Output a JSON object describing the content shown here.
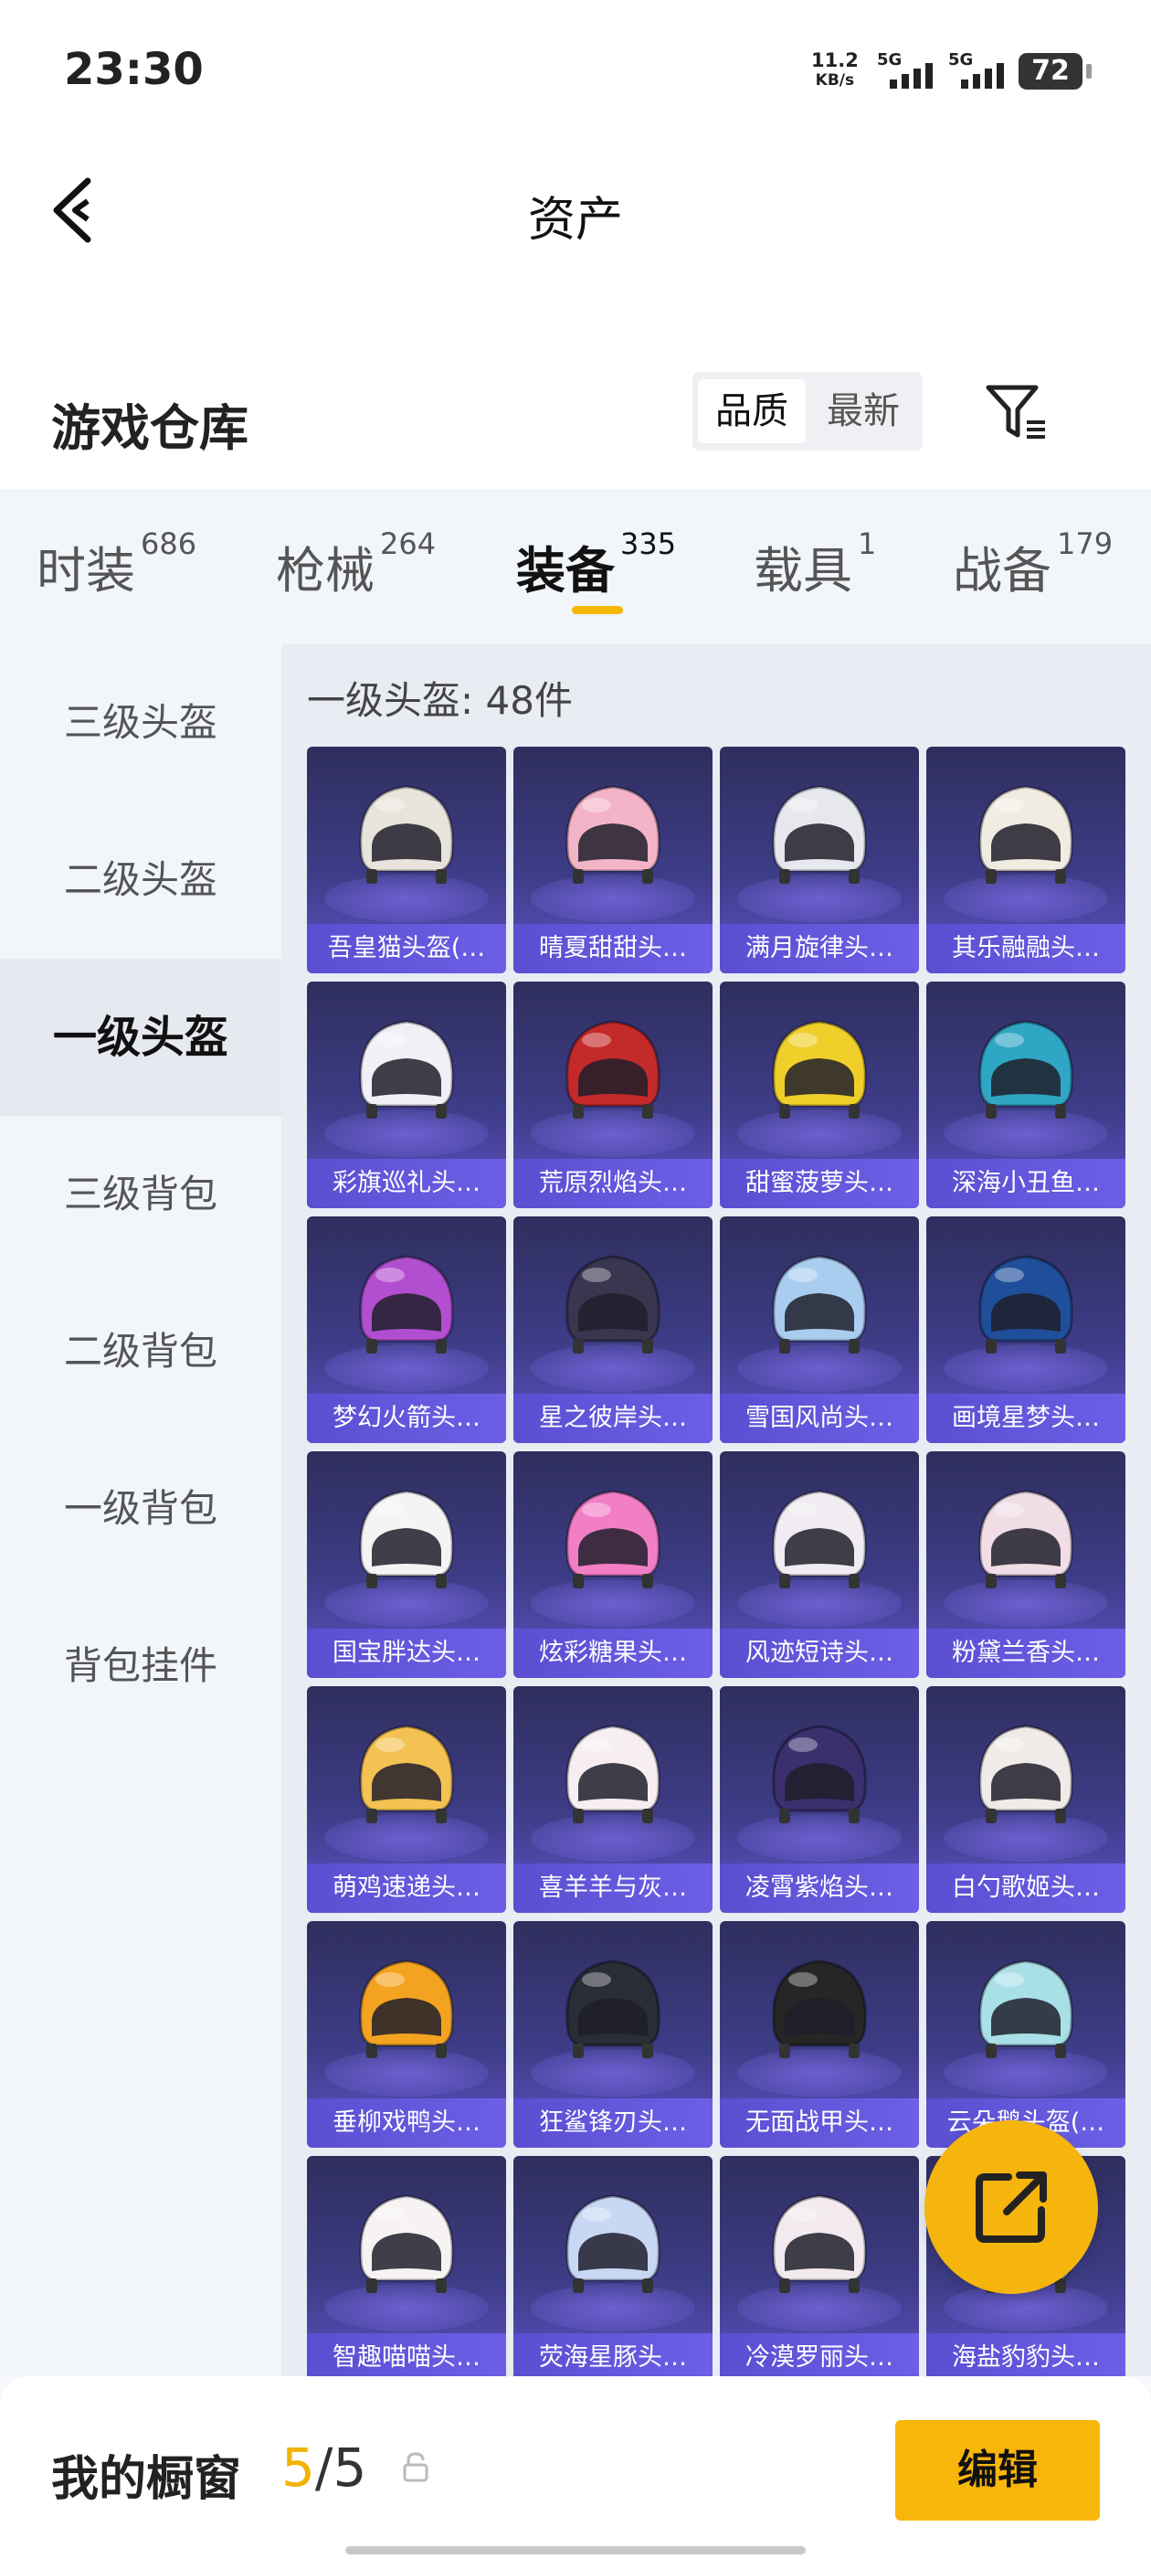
{
  "status_bar": {
    "time": "23:30",
    "net_speed_value": "11.2",
    "net_speed_unit": "KB/s",
    "signal1_label": "5G",
    "signal2_label": "5G",
    "battery": "72"
  },
  "header": {
    "title": "资产",
    "back_icon": "chevron-left-icon"
  },
  "section": {
    "title": "游戏仓库",
    "sort_options": [
      "品质",
      "最新"
    ],
    "sort_selected": "品质",
    "filter_icon": "filter-icon"
  },
  "tabs": [
    {
      "label": "时装",
      "count": "686"
    },
    {
      "label": "枪械",
      "count": "264"
    },
    {
      "label": "装备",
      "count": "335"
    },
    {
      "label": "载具",
      "count": "1"
    },
    {
      "label": "战备",
      "count": "179"
    }
  ],
  "active_tab": "装备",
  "sidebar": {
    "items": [
      "三级头盔",
      "二级头盔",
      "一级头盔",
      "三级背包",
      "二级背包",
      "一级背包",
      "背包挂件"
    ],
    "selected": "一级头盔"
  },
  "main": {
    "count_label": "一级头盔: 48件"
  },
  "items": [
    {
      "label": "吾皇猫头盔(…",
      "color": "#e8e4dc"
    },
    {
      "label": "晴夏甜甜头…",
      "color": "#f4b4c8"
    },
    {
      "label": "满月旋律头…",
      "color": "#e6e8ee"
    },
    {
      "label": "其乐融融头…",
      "color": "#f1ece2"
    },
    {
      "label": "彩旗巡礼头…",
      "color": "#f2f0f6"
    },
    {
      "label": "荒原烈焰头…",
      "color": "#c42a2a"
    },
    {
      "label": "甜蜜菠萝头…",
      "color": "#f0cf2a"
    },
    {
      "label": "深海小丑鱼…",
      "color": "#2fa6c4"
    },
    {
      "label": "梦幻火箭头…",
      "color": "#b24fd0"
    },
    {
      "label": "星之彼岸头…",
      "color": "#3a3650"
    },
    {
      "label": "雪国风尚头…",
      "color": "#a9cdef"
    },
    {
      "label": "画境星梦头…",
      "color": "#1f4f9a"
    },
    {
      "label": "国宝胖达头…",
      "color": "#f4f4f4"
    },
    {
      "label": "炫彩糖果头…",
      "color": "#f27fc6"
    },
    {
      "label": "风迹短诗头…",
      "color": "#f0ecf2"
    },
    {
      "label": "粉黛兰香头…",
      "color": "#f1dde6"
    },
    {
      "label": "萌鸡速递头…",
      "color": "#f4c252"
    },
    {
      "label": "喜羊羊与灰…",
      "color": "#f6eef0"
    },
    {
      "label": "凌霄紫焰头…",
      "color": "#3b2f6e"
    },
    {
      "label": "白勺歌姬头…",
      "color": "#f0ebe8"
    },
    {
      "label": "垂柳戏鸭头…",
      "color": "#f4a320"
    },
    {
      "label": "狂鲨锋刃头…",
      "color": "#2a2c36"
    },
    {
      "label": "无面战甲头…",
      "color": "#262626"
    },
    {
      "label": "云朵鹅头盔(…",
      "color": "#a9e0e8"
    },
    {
      "label": "智趣喵喵头…",
      "color": "#f6f3f2"
    },
    {
      "label": "荧海星豚头…",
      "color": "#c8d7f4"
    },
    {
      "label": "冷漠罗丽头…",
      "color": "#f2eaee"
    },
    {
      "label": "海盐豹豹头…",
      "color": "#9fd8e0"
    }
  ],
  "bottom_bar": {
    "label": "我的橱窗",
    "current": "5",
    "separator": "/",
    "total": "5",
    "lock_icon": "lock-icon",
    "edit_label": "编辑"
  },
  "fab_icon": "share-external-icon",
  "colors": {
    "accent": "#f6b50d",
    "card_purple": "#5a4fd1"
  }
}
